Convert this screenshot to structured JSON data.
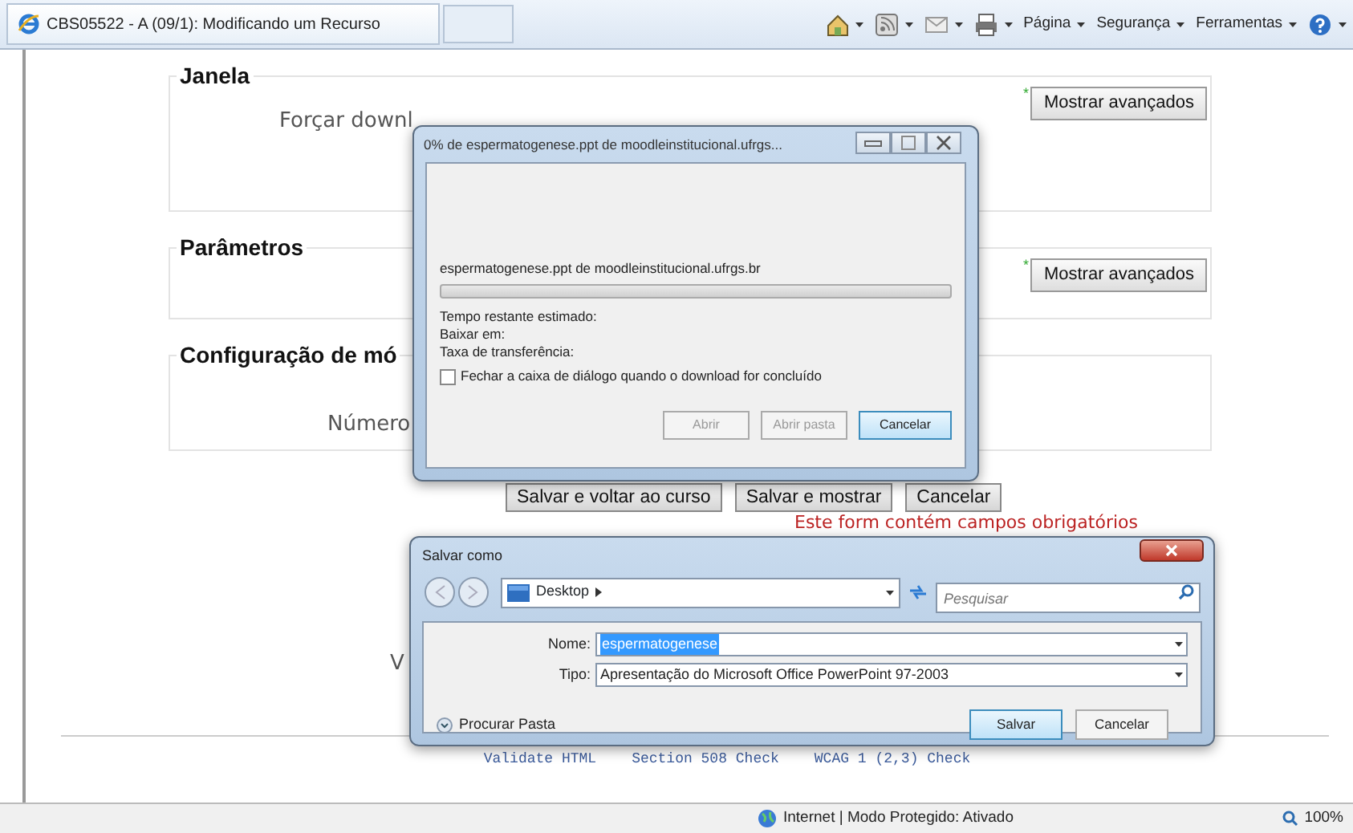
{
  "browser": {
    "tab_title": "CBS05522 - A (09/1): Modificando um Recurso",
    "commands": [
      {
        "kind": "home"
      },
      {
        "kind": "feeds"
      },
      {
        "kind": "mail"
      },
      {
        "kind": "print"
      },
      {
        "kind": "menu",
        "label": "Página"
      },
      {
        "kind": "menu",
        "label": "Segurança"
      },
      {
        "kind": "menu",
        "label": "Ferramentas"
      },
      {
        "kind": "help"
      }
    ]
  },
  "sections": [
    {
      "legend": "Janela",
      "field_label": "Forçar downl",
      "required_mark": "*",
      "button": "Mostrar avançados"
    },
    {
      "legend": "Parâmetros",
      "required_mark": "*",
      "button": "Mostrar avançados"
    },
    {
      "legend": "Configuração de mó",
      "field_label": "Número"
    }
  ],
  "form_buttons": [
    "Salvar e voltar ao curso",
    "Salvar e mostrar",
    "Cancelar"
  ],
  "required_note": "Este form contém campos obrigatórios",
  "cut_label": "V",
  "footer_links": [
    "Validate HTML",
    "Section 508 Check",
    "WCAG 1 (2,3) Check"
  ],
  "status_bar": {
    "zone": "Internet | Modo Protegido: Ativado",
    "zoom": "100%"
  },
  "download_dialog": {
    "title": "0% de espermatogenese.ppt de moodleinstitucional.ufrgs...",
    "file": "espermatogenese.ppt de moodleinstitucional.ufrgs.br",
    "level": 0,
    "lines": [
      "Tempo restante estimado:",
      "Baixar em:",
      "Taxa de transferência:"
    ],
    "close_when_done": {
      "label": "Fechar a caixa de diálogo quando o download for concluído",
      "checked": false
    },
    "buttons": [
      {
        "label": "Abrir",
        "disabled": true,
        "default": false
      },
      {
        "label": "Abrir pasta",
        "disabled": true,
        "default": false
      },
      {
        "label": "Cancelar",
        "disabled": false,
        "default": true
      }
    ]
  },
  "save_dialog": {
    "title": "Salvar como",
    "location": "Desktop",
    "search": {
      "placeholder": "Pesquisar"
    },
    "name_label": "Nome:",
    "name_value": "espermatogenese",
    "type_label": "Tipo:",
    "type_value": "Apresentação do Microsoft Office PowerPoint 97-2003",
    "browse": "Procurar Pasta",
    "buttons": [
      {
        "label": "Salvar",
        "default": true
      },
      {
        "label": "Cancelar",
        "default": false
      }
    ]
  }
}
